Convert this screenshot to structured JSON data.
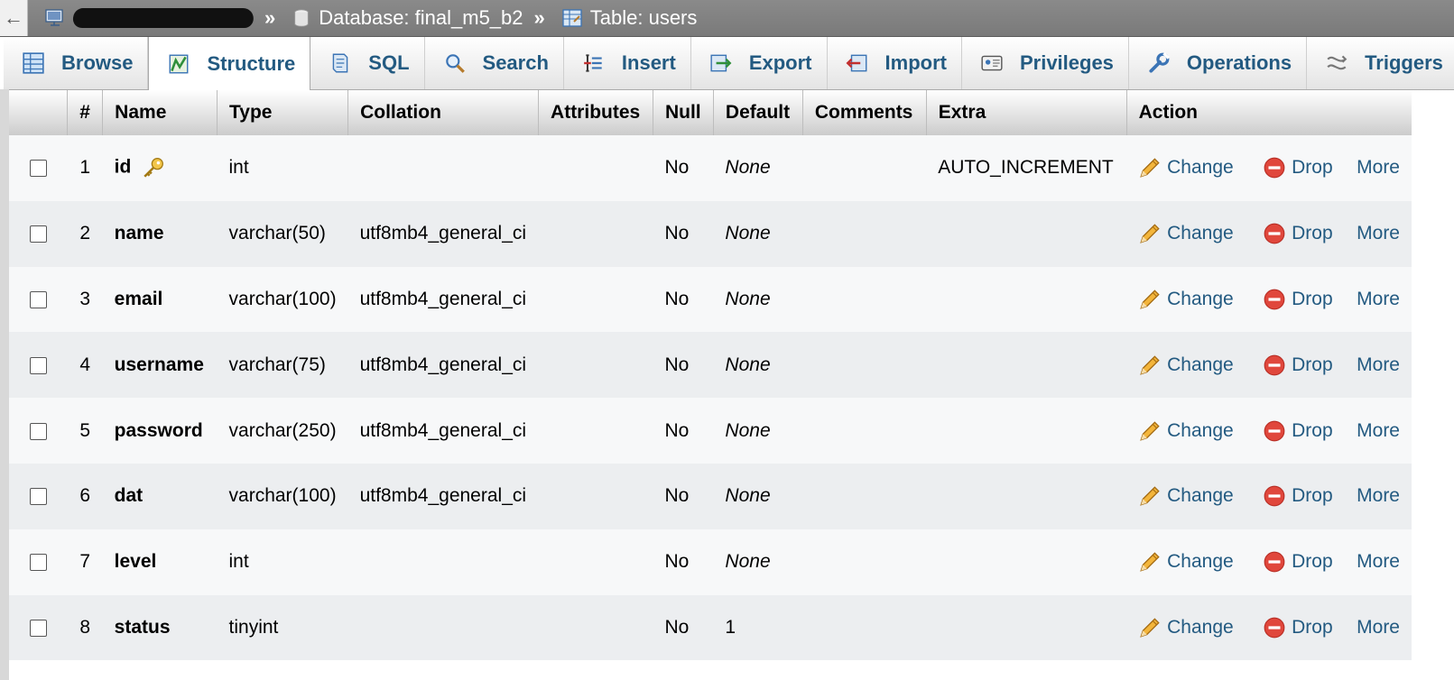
{
  "breadcrumb": {
    "back_glyph": "←",
    "server_label": "",
    "database_label": "Database: final_m5_b2",
    "table_label": "Table: users",
    "separator": "»"
  },
  "tabs": [
    {
      "label": "Browse",
      "icon": "browse-icon",
      "active": false
    },
    {
      "label": "Structure",
      "icon": "structure-icon",
      "active": true
    },
    {
      "label": "SQL",
      "icon": "sql-icon",
      "active": false
    },
    {
      "label": "Search",
      "icon": "search-icon",
      "active": false
    },
    {
      "label": "Insert",
      "icon": "insert-icon",
      "active": false
    },
    {
      "label": "Export",
      "icon": "export-icon",
      "active": false
    },
    {
      "label": "Import",
      "icon": "import-icon",
      "active": false
    },
    {
      "label": "Privileges",
      "icon": "privileges-icon",
      "active": false
    },
    {
      "label": "Operations",
      "icon": "operations-icon",
      "active": false
    },
    {
      "label": "Triggers",
      "icon": "triggers-icon",
      "active": false
    }
  ],
  "table": {
    "headers": {
      "num": "#",
      "name": "Name",
      "type": "Type",
      "collation": "Collation",
      "attributes": "Attributes",
      "null": "Null",
      "default": "Default",
      "comments": "Comments",
      "extra": "Extra",
      "action": "Action"
    },
    "action_labels": {
      "change": "Change",
      "drop": "Drop",
      "more": "More"
    },
    "rows": [
      {
        "num": "1",
        "name": "id",
        "primary_key": true,
        "type": "int",
        "collation": "",
        "attributes": "",
        "null": "No",
        "default": "None",
        "comments": "",
        "extra": "AUTO_INCREMENT"
      },
      {
        "num": "2",
        "name": "name",
        "primary_key": false,
        "type": "varchar(50)",
        "collation": "utf8mb4_general_ci",
        "attributes": "",
        "null": "No",
        "default": "None",
        "comments": "",
        "extra": ""
      },
      {
        "num": "3",
        "name": "email",
        "primary_key": false,
        "type": "varchar(100)",
        "collation": "utf8mb4_general_ci",
        "attributes": "",
        "null": "No",
        "default": "None",
        "comments": "",
        "extra": ""
      },
      {
        "num": "4",
        "name": "username",
        "primary_key": false,
        "type": "varchar(75)",
        "collation": "utf8mb4_general_ci",
        "attributes": "",
        "null": "No",
        "default": "None",
        "comments": "",
        "extra": ""
      },
      {
        "num": "5",
        "name": "password",
        "primary_key": false,
        "type": "varchar(250)",
        "collation": "utf8mb4_general_ci",
        "attributes": "",
        "null": "No",
        "default": "None",
        "comments": "",
        "extra": ""
      },
      {
        "num": "6",
        "name": "dat",
        "primary_key": false,
        "type": "varchar(100)",
        "collation": "utf8mb4_general_ci",
        "attributes": "",
        "null": "No",
        "default": "None",
        "comments": "",
        "extra": ""
      },
      {
        "num": "7",
        "name": "level",
        "primary_key": false,
        "type": "int",
        "collation": "",
        "attributes": "",
        "null": "No",
        "default": "None",
        "comments": "",
        "extra": ""
      },
      {
        "num": "8",
        "name": "status",
        "primary_key": false,
        "type": "tinyint",
        "collation": "",
        "attributes": "",
        "null": "No",
        "default": "1",
        "comments": "",
        "extra": ""
      }
    ]
  },
  "colors": {
    "link": "#235a81",
    "breadcrumb_bg": "#828282",
    "row_odd": "#f7f8f9",
    "row_even": "#eceef0"
  }
}
